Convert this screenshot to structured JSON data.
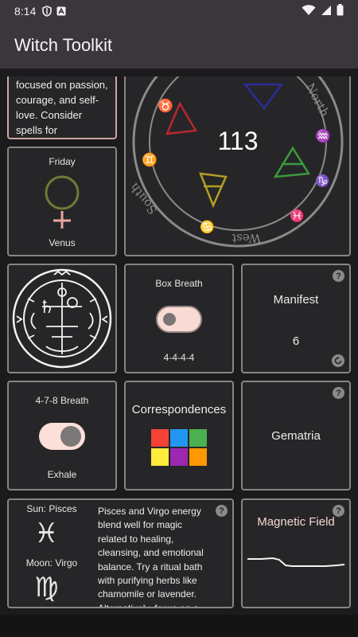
{
  "status": {
    "time": "8:14"
  },
  "app": {
    "title": "Witch Toolkit"
  },
  "spell_card": {
    "text": "focused on passion, courage, and self-love. Consider spells for"
  },
  "day_card": {
    "day": "Friday",
    "planet": "Venus",
    "symbol_color": "#6e7a38",
    "cross_color": "#e7a6a2"
  },
  "wheel": {
    "number": "113",
    "words": [
      "North",
      "South",
      "West"
    ],
    "triangle_colors": [
      "#b8282d",
      "#2c2c9a",
      "#3a9a3e",
      "#b39e24"
    ]
  },
  "box_breath": {
    "title": "Box Breath",
    "pattern": "4-4-4-4"
  },
  "manifest": {
    "title": "Manifest",
    "count": "6"
  },
  "breath_478": {
    "title": "4-7-8 Breath",
    "phase": "Exhale"
  },
  "correspondences": {
    "title": "Correspondences",
    "colors": [
      "#f44336",
      "#2196f3",
      "#4caf50",
      "#ffeb3b",
      "#9c27b0",
      "#ff9800"
    ]
  },
  "gematria": {
    "title": "Gematria"
  },
  "astro": {
    "sun": "Sun: Pisces",
    "moon": "Moon: Virgo",
    "description": "Pisces and Virgo energy blend well for magic related to healing, cleansing, and emotional balance. Try a ritual bath with purifying herbs like chamomile or lavender. Alternatively, focus on a"
  },
  "magnetic": {
    "title": "Magnetic Field"
  },
  "colors": {
    "accent": "#fadad5",
    "card_border": "#8b8382",
    "card_bg": "#262628",
    "app_bar": "#3b363b"
  }
}
